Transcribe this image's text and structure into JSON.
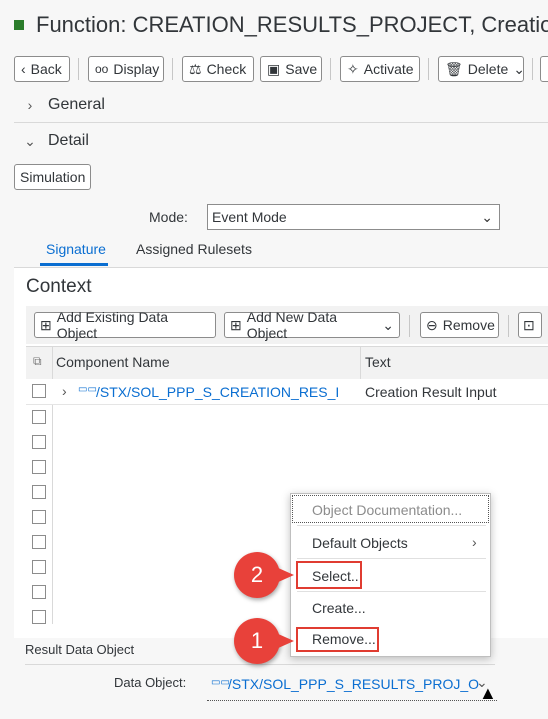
{
  "header": {
    "title": "Function: CREATION_RESULTS_PROJECT, Creation"
  },
  "toolbar": {
    "back": "Back",
    "display": "Display",
    "check": "Check",
    "save": "Save",
    "activate": "Activate",
    "delete": "Delete"
  },
  "sections": {
    "general": "General",
    "detail": "Detail"
  },
  "detail": {
    "simulation": "Simulation",
    "mode_label": "Mode:",
    "mode_value": "Event Mode"
  },
  "tabs": {
    "signature": "Signature",
    "assigned_rulesets": "Assigned Rulesets"
  },
  "context": {
    "title": "Context",
    "add_existing": "Add Existing Data Object",
    "add_new": "Add New Data Object",
    "remove": "Remove",
    "columns": {
      "component_name": "Component Name",
      "text": "Text"
    },
    "rows": [
      {
        "component_name": "/STX/SOL_PPP_S_CREATION_RES_I",
        "text": "Creation Result Input"
      }
    ]
  },
  "result": {
    "label": "Result Data Object",
    "data_object_label": "Data Object:",
    "data_object_value": "/STX/SOL_PPP_S_RESULTS_PROJ_O"
  },
  "context_menu": {
    "items": [
      "Object Documentation...",
      "Default Objects",
      "Select...",
      "Create...",
      "Remove..."
    ]
  },
  "callouts": {
    "first": "1",
    "second": "2"
  },
  "colors": {
    "accent": "#0a6ed1",
    "callout": "#e8413a",
    "status": "#2b7d2b"
  }
}
